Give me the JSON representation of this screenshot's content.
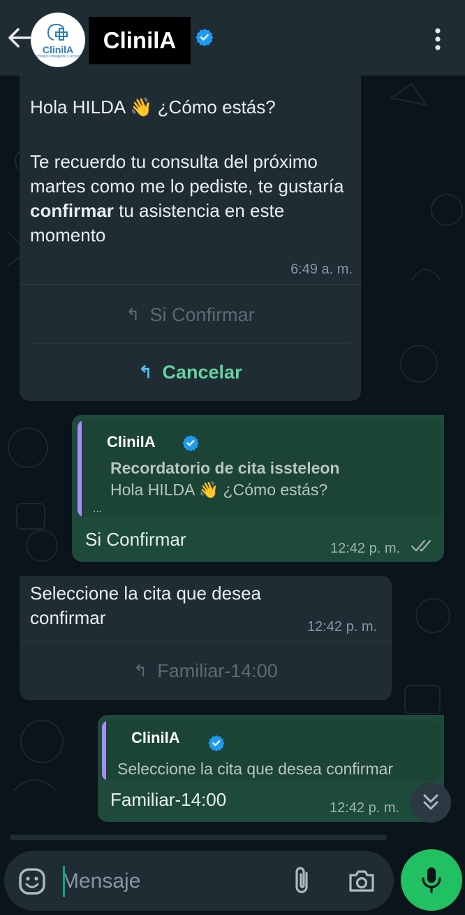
{
  "header": {
    "contact_name": "ClinilA",
    "avatar_logo_text": "ClinilA",
    "avatar_logo_subtitle": "Diagnóstico inteligente y accesible"
  },
  "messages": [
    {
      "direction": "incoming",
      "greeting": "Hola HILDA 👋 ¿Cómo estás?",
      "body_before": "Te recuerdo tu consulta del próximo martes como me lo pediste, te gustaría ",
      "body_bold": "confirmar",
      "body_after": " tu asistencia en este momento",
      "time": "6:49 a. m.",
      "quick_replies": [
        {
          "label": "Si Confirmar",
          "state": "disabled"
        },
        {
          "label": "Cancelar",
          "state": "active"
        }
      ]
    },
    {
      "direction": "outgoing",
      "quote": {
        "author": "ClinilA",
        "title": "Recordatorio de cita issteleon",
        "text": "Hola HILDA 👋 ¿Cómo estás?",
        "ellipsis": "..."
      },
      "text": "Si Confirmar",
      "time": "12:42 p. m."
    },
    {
      "direction": "incoming",
      "text": "Seleccione la cita que desea confirmar",
      "time": "12:42 p. m.",
      "quick_replies": [
        {
          "label": "Familiar-14:00",
          "state": "disabled"
        }
      ]
    },
    {
      "direction": "outgoing",
      "quote": {
        "author": "ClinilA",
        "text": "Seleccione la cita que desea confirmar"
      },
      "text": "Familiar-14:00",
      "time": "12:42 p. m."
    }
  ],
  "composer": {
    "placeholder": "Mensaje"
  },
  "colors": {
    "header_bg": "#1f2c34",
    "chat_bg": "#0b141a",
    "incoming_bubble": "#1f2c34",
    "outgoing_bubble": "#1e4a3b",
    "accent_green": "#21c063",
    "verified_blue": "#1d9bf0",
    "quote_bar": "#a78bfa"
  },
  "icons": [
    "back-arrow-icon",
    "verified-icon",
    "more-vert-icon",
    "reply-icon",
    "double-check-icon",
    "chevron-double-down-icon",
    "emoji-icon",
    "attach-icon",
    "camera-icon",
    "mic-icon"
  ]
}
